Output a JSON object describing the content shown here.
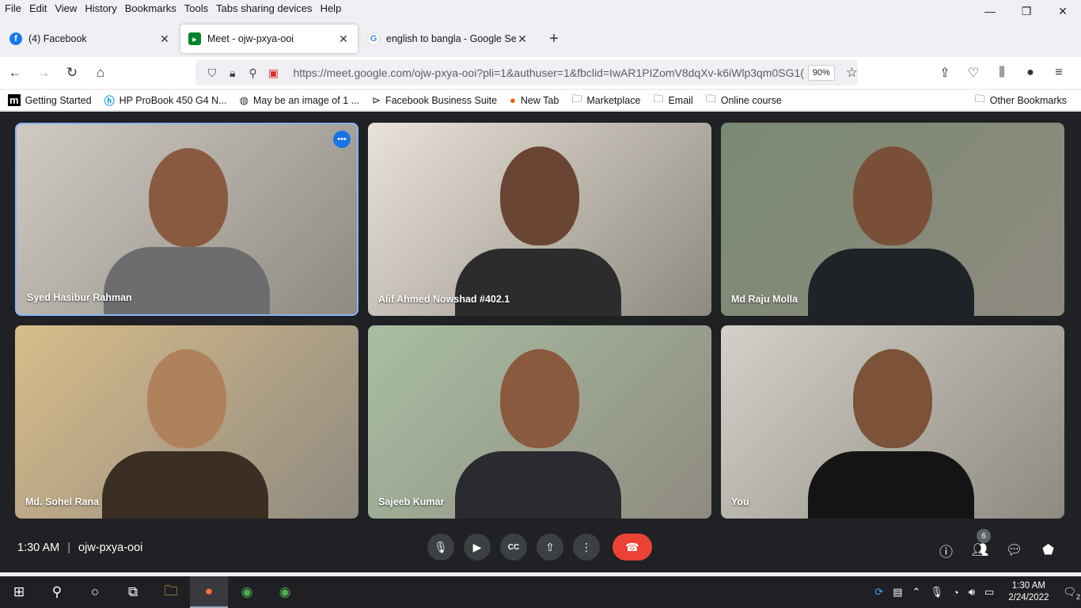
{
  "menubar": {
    "items": [
      "File",
      "Edit",
      "View",
      "History",
      "Bookmarks",
      "Tools",
      "Tabs sharing devices",
      "Help"
    ]
  },
  "window": {
    "minimize": "—",
    "restore": "❐",
    "close": "✕"
  },
  "tabs": [
    {
      "label": "(4) Facebook",
      "icon": "facebook-icon",
      "color": "#1877f2"
    },
    {
      "label": "Meet - ojw-pxya-ooi",
      "icon": "meet-icon",
      "color": "#00832d"
    },
    {
      "label": "english to bangla - Google Sear",
      "icon": "google-icon",
      "color": "#4285f4"
    }
  ],
  "navbar": {
    "url": "https://meet.google.com/ojw-pxya-ooi?pli=1&authuser=1&fbclid=IwAR1PIZomV8dqXv-k6iWlp3qm0SG1(",
    "zoom": "90%"
  },
  "bookmarks": [
    {
      "label": "Getting Started",
      "icon": "m-icon"
    },
    {
      "label": "HP ProBook 450 G4 N...",
      "icon": "hp-icon"
    },
    {
      "label": "May be an image of 1 ...",
      "icon": "globe-icon"
    },
    {
      "label": "Facebook Business Suite",
      "icon": "fb-suite-icon"
    },
    {
      "label": "New Tab",
      "icon": "firefox-icon"
    },
    {
      "label": "Marketplace",
      "icon": "folder-icon"
    },
    {
      "label": "Email",
      "icon": "folder-icon"
    },
    {
      "label": "Online course",
      "icon": "folder-icon"
    }
  ],
  "other_bookmarks": "Other Bookmarks",
  "participants": [
    {
      "name": "Syed Hasibur Rahman",
      "bg": "#cfcac4",
      "skin": "#8a5a40",
      "shirt": "#6d6d70"
    },
    {
      "name": "Alif Ahmed Nowshad #402.1",
      "bg": "#e8e2d8",
      "skin": "#6b4533",
      "shirt": "#2c2c2c"
    },
    {
      "name": "Md Raju Molla",
      "bg": "#7a8a72",
      "skin": "#7a4f37",
      "shirt": "#1e2328"
    },
    {
      "name": "Md. Sohel Rana",
      "bg": "#d8bc8a",
      "skin": "#b0825c",
      "shirt": "#3b2e22"
    },
    {
      "name": "Sajeeb Kumar",
      "bg": "#a8bfa2",
      "skin": "#8b5a3e",
      "shirt": "#2a2a30"
    },
    {
      "name": "You",
      "bg": "#d2d0c8",
      "skin": "#7c5238",
      "shirt": "#141414"
    }
  ],
  "meeting": {
    "time": "1:30 AM",
    "code": "ojw-pxya-ooi",
    "participant_count": "6"
  },
  "taskbar": {
    "time": "1:30 AM",
    "date": "2/24/2022",
    "notifications": "2"
  }
}
